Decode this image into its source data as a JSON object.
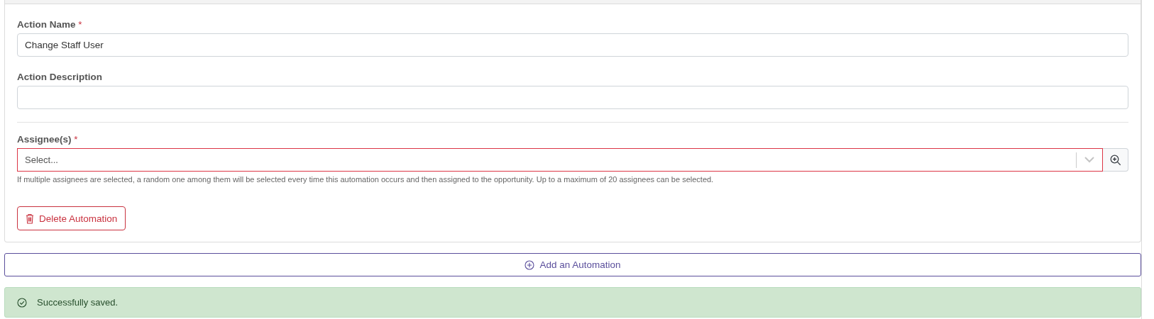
{
  "fields": [
    {
      "kind": "text",
      "label": "Action Name",
      "required_mark": "*",
      "value": "Change Staff User"
    },
    {
      "kind": "text",
      "label": "Action Description"
    },
    {
      "kind": "divider"
    },
    {
      "kind": "select",
      "label": "Assignee(s)",
      "required_mark": "*",
      "invalid": true,
      "placeholder": "Select...",
      "help": "If multiple assignees are selected, a random one among them will be selected every time this automation occurs and then assigned to the opportunity. Up to a maximum of 20 assignees can be selected."
    }
  ],
  "delete_button": "Delete Automation",
  "add_button": "Add an Automation",
  "alert": {
    "kind": "success",
    "text": "Successfully saved."
  }
}
